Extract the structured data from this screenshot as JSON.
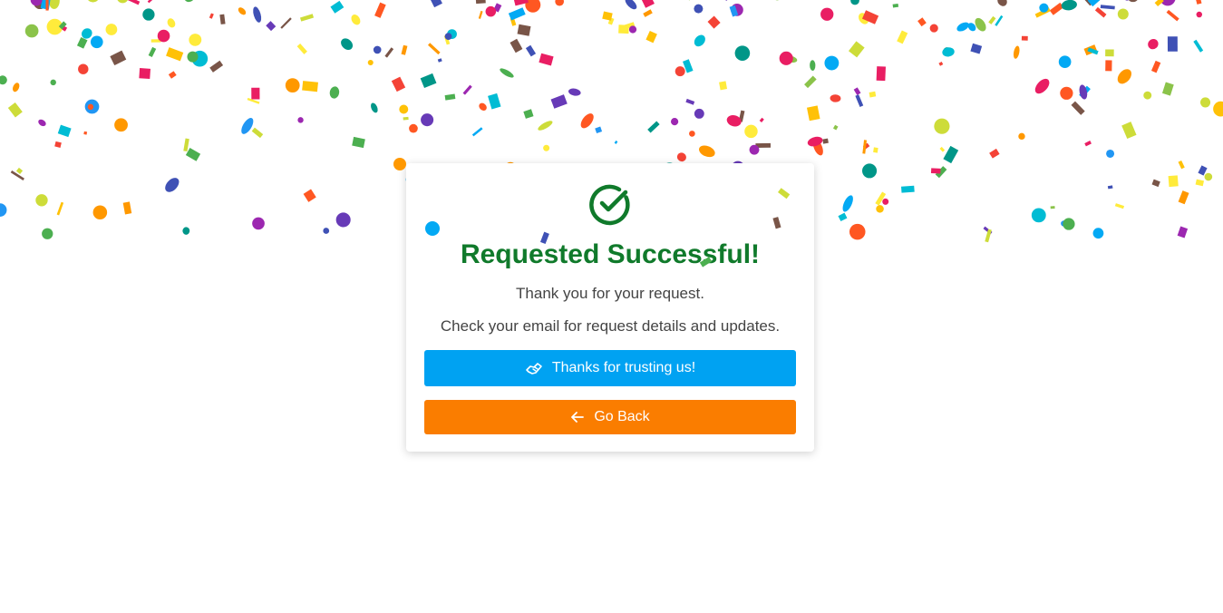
{
  "card": {
    "icon": "check-circle-icon",
    "title": "Requested Successful!",
    "message_line1": "Thank you for your request.",
    "message_line2": "Check your email for request details and updates.",
    "thanks_button": {
      "label": "Thanks for trusting us!",
      "icon": "handshake-icon",
      "color": "#00a2f2"
    },
    "back_button": {
      "label": "Go Back",
      "icon": "arrow-left-icon",
      "color": "#fa7d00"
    },
    "title_color": "#107a2b"
  },
  "colors": {
    "confetti_palette": [
      "#e91e63",
      "#9c27b0",
      "#673ab7",
      "#3f51b5",
      "#2196f3",
      "#03a9f4",
      "#00bcd4",
      "#009688",
      "#4caf50",
      "#8bc34a",
      "#cddc39",
      "#ffeb3b",
      "#ffc107",
      "#ff9800",
      "#ff5722",
      "#795548",
      "#f44336"
    ]
  }
}
